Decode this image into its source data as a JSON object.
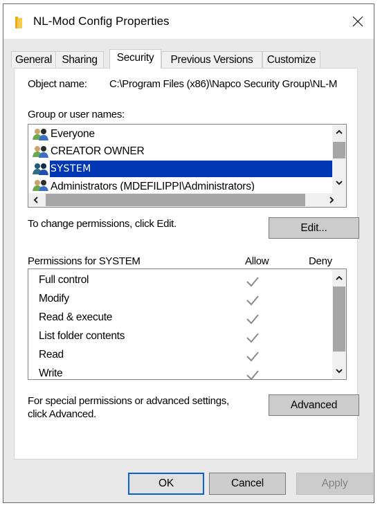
{
  "window": {
    "title": "NL-Mod Config Properties",
    "icon": "folder-icon",
    "close_icon": "close-icon"
  },
  "tabs": [
    {
      "label": "General",
      "active": false
    },
    {
      "label": "Sharing",
      "active": false
    },
    {
      "label": "Security",
      "active": true
    },
    {
      "label": "Previous Versions",
      "active": false
    },
    {
      "label": "Customize",
      "active": false
    }
  ],
  "security": {
    "object_name_label": "Object name:",
    "object_name_value": "C:\\Program Files (x86)\\Napco Security Group\\NL-M",
    "group_label": "Group or user names:",
    "users": [
      {
        "name": "Everyone",
        "selected": false,
        "icon": "users-group-icon"
      },
      {
        "name": "CREATOR OWNER",
        "selected": false,
        "icon": "users-group-icon"
      },
      {
        "name": "SYSTEM",
        "selected": true,
        "icon": "users-group-icon"
      },
      {
        "name": "Administrators (MDEFILIPPI\\Administrators)",
        "selected": false,
        "icon": "users-group-icon"
      }
    ],
    "change_hint": "To change permissions, click Edit.",
    "edit_button": "Edit...",
    "permissions_label": "Permissions for SYSTEM",
    "allow_header": "Allow",
    "deny_header": "Deny",
    "permissions": [
      {
        "name": "Full control",
        "allow": true,
        "deny": false
      },
      {
        "name": "Modify",
        "allow": true,
        "deny": false
      },
      {
        "name": "Read & execute",
        "allow": true,
        "deny": false
      },
      {
        "name": "List folder contents",
        "allow": true,
        "deny": false
      },
      {
        "name": "Read",
        "allow": true,
        "deny": false
      },
      {
        "name": "Write",
        "allow": true,
        "deny": false
      }
    ],
    "advanced_hint_line1": "For special permissions or advanced settings,",
    "advanced_hint_line2": "click Advanced.",
    "advanced_button": "Advanced"
  },
  "footer": {
    "ok": "OK",
    "cancel": "Cancel",
    "apply": "Apply"
  },
  "colors": {
    "selection": "#0037b4",
    "default_button_border": "#0a5fd0",
    "check": "#8a8a8a"
  }
}
